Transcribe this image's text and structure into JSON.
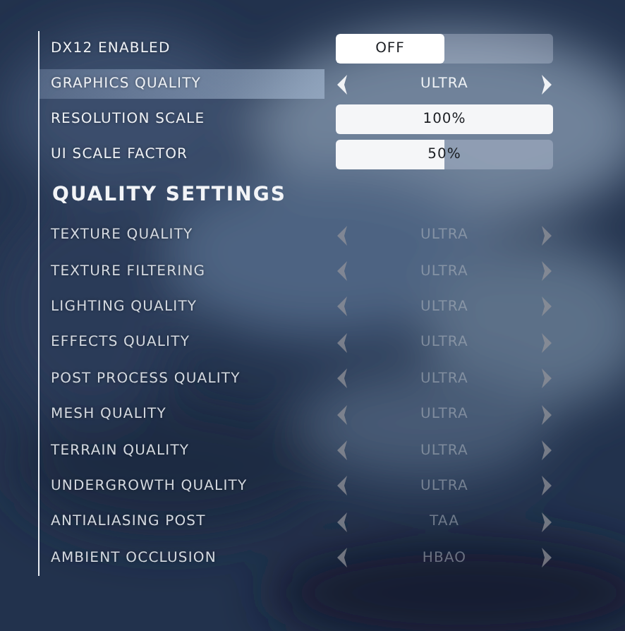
{
  "general": [
    {
      "kind": "toggle",
      "label": "DX12 ENABLED",
      "value": "OFF",
      "on": false,
      "selected": false
    },
    {
      "kind": "selector",
      "label": "GRAPHICS QUALITY",
      "value": "ULTRA",
      "selected": true
    },
    {
      "kind": "slider",
      "label": "RESOLUTION SCALE",
      "value": "100%",
      "level": 1,
      "selected": false
    },
    {
      "kind": "slider",
      "label": "UI SCALE FACTOR",
      "value": "50%",
      "level": 0.5,
      "selected": false
    }
  ],
  "section_title": "QUALITY SETTINGS",
  "quality": [
    {
      "label": "TEXTURE QUALITY",
      "value": "ULTRA",
      "disabled": true
    },
    {
      "label": "TEXTURE FILTERING",
      "value": "ULTRA",
      "disabled": true
    },
    {
      "label": "LIGHTING QUALITY",
      "value": "ULTRA",
      "disabled": true
    },
    {
      "label": "EFFECTS QUALITY",
      "value": "ULTRA",
      "disabled": true
    },
    {
      "label": "POST PROCESS QUALITY",
      "value": "ULTRA",
      "disabled": true
    },
    {
      "label": "MESH QUALITY",
      "value": "ULTRA",
      "disabled": true
    },
    {
      "label": "TERRAIN QUALITY",
      "value": "ULTRA",
      "disabled": true
    },
    {
      "label": "UNDERGROWTH QUALITY",
      "value": "ULTRA",
      "disabled": true
    },
    {
      "label": "ANTIALIASING POST",
      "value": "TAA",
      "disabled": true
    },
    {
      "label": "AMBIENT OCCLUSION",
      "value": "HBAO",
      "disabled": true
    }
  ]
}
